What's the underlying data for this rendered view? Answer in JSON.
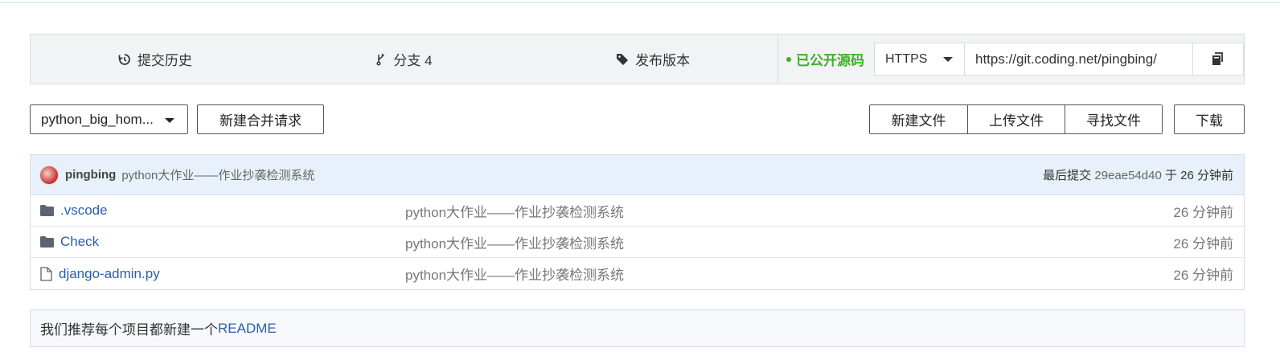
{
  "stats": {
    "history_label": "提交历史",
    "branches_label": "分支 4",
    "releases_label": "发布版本"
  },
  "clone": {
    "visibility": "已公开源码",
    "protocol": "HTTPS",
    "url": "https://git.coding.net/pingbing/"
  },
  "toolbar": {
    "branch": "python_big_hom...",
    "merge_request": "新建合并请求",
    "new_file": "新建文件",
    "upload_file": "上传文件",
    "find_file": "寻找文件",
    "download": "下载"
  },
  "commit": {
    "author": "pingbing",
    "message": "python大作业——作业抄袭检测系统",
    "last_label": "最后提交",
    "hash": "29eae54d40",
    "time": "于 26 分钟前"
  },
  "files": [
    {
      "name": ".vscode",
      "type": "folder",
      "message": "python大作业——作业抄袭检测系统",
      "time": "26 分钟前"
    },
    {
      "name": "Check",
      "type": "folder",
      "message": "python大作业——作业抄袭检测系统",
      "time": "26 分钟前"
    },
    {
      "name": "django-admin.py",
      "type": "file",
      "message": "python大作业——作业抄袭检测系统",
      "time": "26 分钟前"
    }
  ],
  "readme": {
    "text": "我们推荐每个项目都新建一个",
    "link": "README"
  },
  "icons": {
    "history": "history-icon",
    "branch": "branch-icon",
    "tag": "tag-icon",
    "copy": "copy-icon",
    "folder": "folder-icon",
    "file": "file-icon"
  },
  "colors": {
    "public": "#3fae2a",
    "link": "#2b5ea8",
    "commit_bar": "#e8f1fb"
  }
}
